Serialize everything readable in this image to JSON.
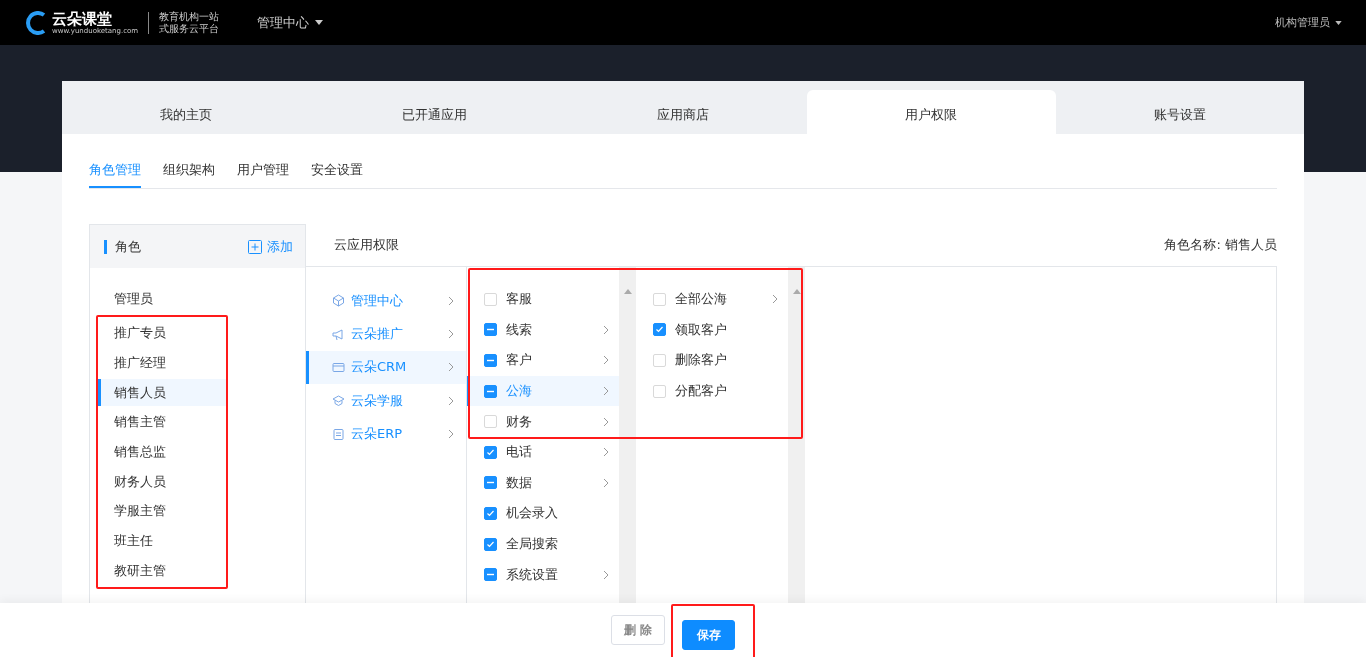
{
  "topbar": {
    "logo_name": "云朵课堂",
    "logo_url": "www.yunduoketang.com",
    "slogan": [
      "教育机构一站",
      "式服务云平台"
    ],
    "menu": "管理中心",
    "user": "机构管理员"
  },
  "main_tabs": [
    {
      "label": "我的主页",
      "selected": false
    },
    {
      "label": "已开通应用",
      "selected": false
    },
    {
      "label": "应用商店",
      "selected": false
    },
    {
      "label": "用户权限",
      "selected": true
    },
    {
      "label": "账号设置",
      "selected": false
    }
  ],
  "sub_tabs": [
    {
      "label": "角色管理",
      "selected": true
    },
    {
      "label": "组织架构",
      "selected": false
    },
    {
      "label": "用户管理",
      "selected": false
    },
    {
      "label": "安全设置",
      "selected": false
    }
  ],
  "roles": {
    "title": "角色",
    "add_label": "添加",
    "highlighted": true,
    "items": [
      {
        "label": "管理员",
        "selected": false,
        "highlighted": false
      },
      {
        "label": "推广专员",
        "selected": false,
        "highlighted": true
      },
      {
        "label": "推广经理",
        "selected": false,
        "highlighted": true
      },
      {
        "label": "销售人员",
        "selected": true,
        "highlighted": true
      },
      {
        "label": "销售主管",
        "selected": false,
        "highlighted": true
      },
      {
        "label": "销售总监",
        "selected": false,
        "highlighted": true
      },
      {
        "label": "财务人员",
        "selected": false,
        "highlighted": true
      },
      {
        "label": "学服主管",
        "selected": false,
        "highlighted": true
      },
      {
        "label": "班主任",
        "selected": false,
        "highlighted": true
      },
      {
        "label": "教研主管",
        "selected": false,
        "highlighted": true
      }
    ]
  },
  "permissions": {
    "title": "云应用权限",
    "role_name_label": "角色名称: 销售人员",
    "highlighted": true,
    "apps": [
      {
        "label": "管理中心",
        "kind": "cube",
        "selected": false
      },
      {
        "label": "云朵推广",
        "kind": "megaphone",
        "selected": false
      },
      {
        "label": "云朵CRM",
        "kind": "card",
        "selected": true
      },
      {
        "label": "云朵学服",
        "kind": "cap",
        "selected": false
      },
      {
        "label": "云朵ERP",
        "kind": "doc",
        "selected": false
      }
    ],
    "modules": [
      {
        "label": "客服",
        "checked": false,
        "partial": false,
        "has_children": false,
        "selected": false
      },
      {
        "label": "线索",
        "checked": false,
        "partial": true,
        "has_children": true,
        "selected": false
      },
      {
        "label": "客户",
        "checked": false,
        "partial": true,
        "has_children": true,
        "selected": false
      },
      {
        "label": "公海",
        "checked": false,
        "partial": true,
        "has_children": true,
        "selected": true
      },
      {
        "label": "财务",
        "checked": false,
        "partial": false,
        "has_children": true,
        "selected": false
      },
      {
        "label": "电话",
        "checked": true,
        "partial": false,
        "has_children": true,
        "selected": false
      },
      {
        "label": "数据",
        "checked": false,
        "partial": true,
        "has_children": true,
        "selected": false
      },
      {
        "label": "机会录入",
        "checked": true,
        "partial": false,
        "has_children": false,
        "selected": false
      },
      {
        "label": "全局搜索",
        "checked": true,
        "partial": false,
        "has_children": false,
        "selected": false
      },
      {
        "label": "系统设置",
        "checked": false,
        "partial": true,
        "has_children": true,
        "selected": false
      }
    ],
    "actions": [
      {
        "label": "全部公海",
        "checked": false,
        "partial": false,
        "has_children": true
      },
      {
        "label": "领取客户",
        "checked": true,
        "partial": false,
        "has_children": false
      },
      {
        "label": "删除客户",
        "checked": false,
        "partial": false,
        "has_children": false
      },
      {
        "label": "分配客户",
        "checked": false,
        "partial": false,
        "has_children": false
      }
    ]
  },
  "footer": {
    "buttons": [
      {
        "label": "删 除",
        "kind": "secondary",
        "highlighted": false
      },
      {
        "label": "保存",
        "kind": "primary",
        "highlighted": true
      }
    ]
  }
}
